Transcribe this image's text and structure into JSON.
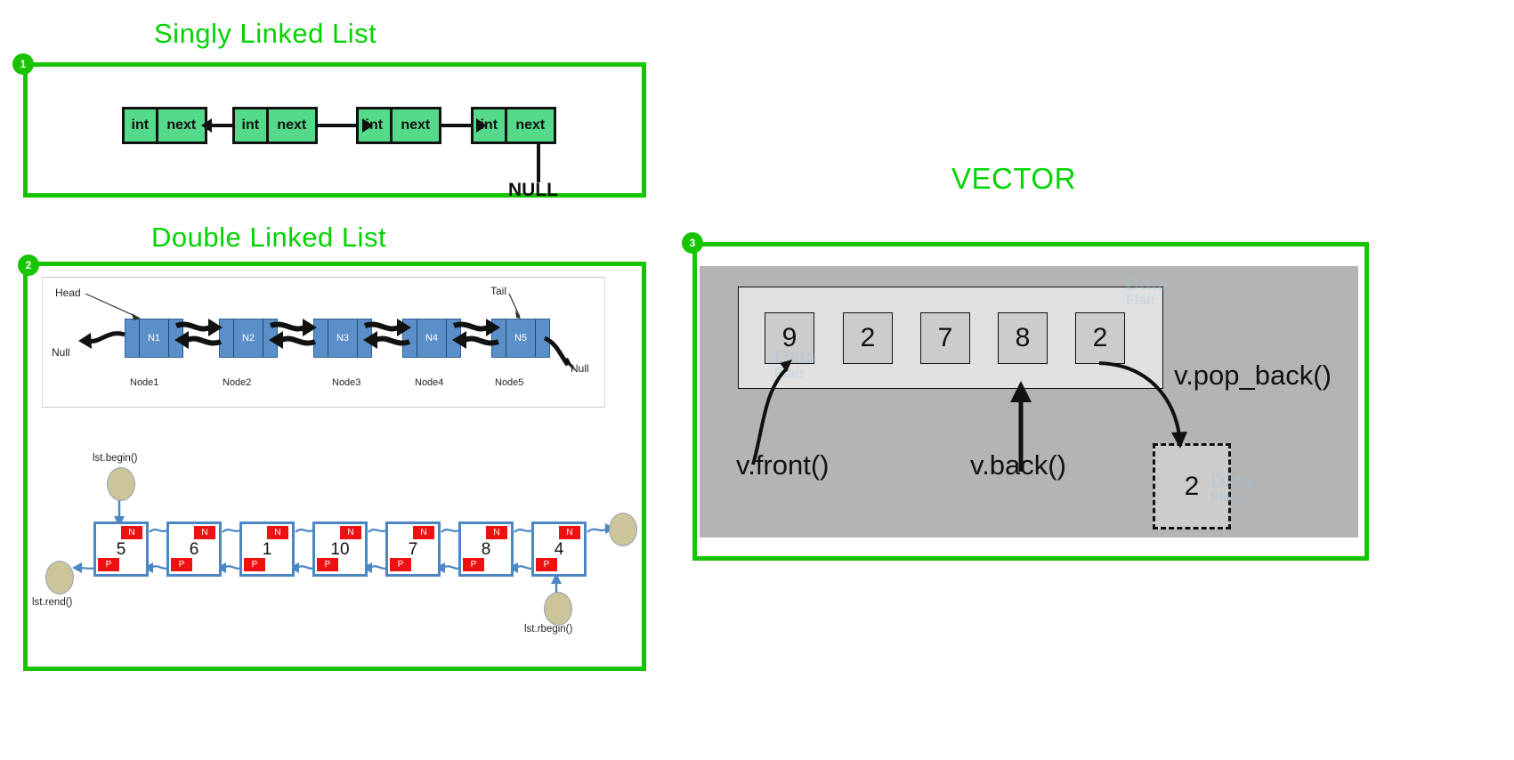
{
  "sections": [
    {
      "badge": "1",
      "title": "Singly Linked List"
    },
    {
      "badge": "2",
      "title": "Double Linked List"
    },
    {
      "badge": "3",
      "title": "VECTOR"
    }
  ],
  "singly_linked_list": {
    "title": "Singly Linked List",
    "badge": "1",
    "nodes": [
      {
        "data_label": "int",
        "pointer_label": "next"
      },
      {
        "data_label": "int",
        "pointer_label": "next"
      },
      {
        "data_label": "int",
        "pointer_label": "next"
      },
      {
        "data_label": "int",
        "pointer_label": "next"
      }
    ],
    "terminator": "NULL"
  },
  "double_linked_list": {
    "title": "Double Linked List",
    "badge": "2",
    "head_label": "Head",
    "tail_label": "Tail",
    "null_left": "Null",
    "null_right": "Null",
    "nodes": [
      {
        "name": "N1",
        "caption": "Node1"
      },
      {
        "name": "N2",
        "caption": "Node2"
      },
      {
        "name": "N3",
        "caption": "Node3"
      },
      {
        "name": "N4",
        "caption": "Node4"
      },
      {
        "name": "N5",
        "caption": "Node5"
      }
    ]
  },
  "list_iterators": {
    "next_tag": "N",
    "prev_tag": "P",
    "values": [
      "5",
      "6",
      "1",
      "10",
      "7",
      "8",
      "4"
    ],
    "begin_label": "lst.begin()",
    "rend_label": "lst.rend()",
    "rbegin_label": "lst.rbegin()"
  },
  "vector": {
    "title": "VECTOR",
    "badge": "3",
    "values": [
      "9",
      "2",
      "7",
      "8",
      "2"
    ],
    "front_label": "v.front()",
    "back_label": "v.back()",
    "pop_back_label": "v.pop_back()",
    "popped_value": "2"
  },
  "watermark": {
    "line1": "Data",
    "line2": "Flair"
  },
  "colors": {
    "frame_green": "#18c400",
    "title_green": "#00d400",
    "sll_node": "#55d98a",
    "dll_node": "#5b8fc9",
    "tag_red": "#ee1111",
    "iterator_border": "#4a87c4",
    "ellipse": "#cdc59a",
    "vector_outer": "#b4b4b4",
    "vector_inner": "#e0e0e0",
    "vector_cell": "#cccccc"
  }
}
